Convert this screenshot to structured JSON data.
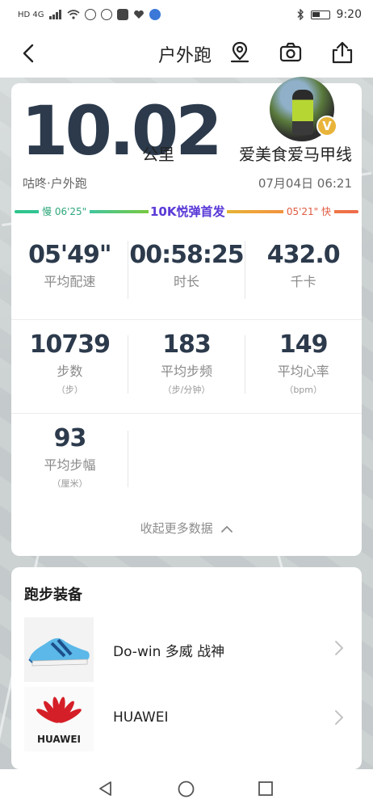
{
  "status_bar": {
    "network": "HD 4G",
    "time": "9:20"
  },
  "nav": {
    "title": "户外跑"
  },
  "run": {
    "distance": "10.02",
    "distance_unit": "公里",
    "username": "爱美食爱马甲线",
    "badge": "V",
    "sport": "咕咚·户外跑",
    "datetime": "07月04日 06:21",
    "pace_slow": "慢 06'25\"",
    "pace_fast": "05'21\" 快",
    "event": "10K悦弹首发"
  },
  "stats": {
    "row1": [
      {
        "value": "05'49\"",
        "label": "平均配速"
      },
      {
        "value": "00:58:25",
        "label": "时长"
      },
      {
        "value": "432.0",
        "label": "千卡"
      }
    ],
    "row2": [
      {
        "value": "10739",
        "label": "步数",
        "sub": "（步）"
      },
      {
        "value": "183",
        "label": "平均步频",
        "sub": "（步/分钟）"
      },
      {
        "value": "149",
        "label": "平均心率",
        "sub": "（bpm）"
      }
    ],
    "row3": [
      {
        "value": "93",
        "label": "平均步幅",
        "sub": "（厘米）"
      }
    ],
    "collapse_label": "收起更多数据"
  },
  "gear": {
    "title": "跑步装备",
    "items": [
      {
        "name": "Do-win 多威 战神"
      },
      {
        "name": "HUAWEI"
      }
    ],
    "huawei_logo_text": "HUAWEI"
  },
  "colors": {
    "accent_dark": "#2c3a4c",
    "pace_slow": "#2ea77a",
    "pace_fast": "#e05a40",
    "event": "#5b3bd6",
    "huawei_red": "#d51f28"
  }
}
